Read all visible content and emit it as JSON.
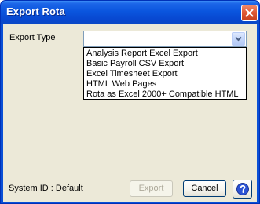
{
  "window": {
    "title": "Export Rota"
  },
  "form": {
    "export_type_label": "Export Type",
    "export_type_value": "",
    "export_type_options": [
      "Analysis Report Excel Export",
      "Basic Payroll CSV Export",
      "Excel Timesheet Export",
      "HTML Web Pages",
      "Rota as Excel 2000+ Compatible HTML"
    ]
  },
  "footer": {
    "system_id": "System ID : Default",
    "export_label": "Export",
    "cancel_label": "Cancel",
    "help_icon": "help-icon"
  },
  "colors": {
    "titlebar": "#0a55de",
    "client_bg": "#ece9d8",
    "close_button": "#e05a36",
    "help_icon": "#2b52d4"
  }
}
